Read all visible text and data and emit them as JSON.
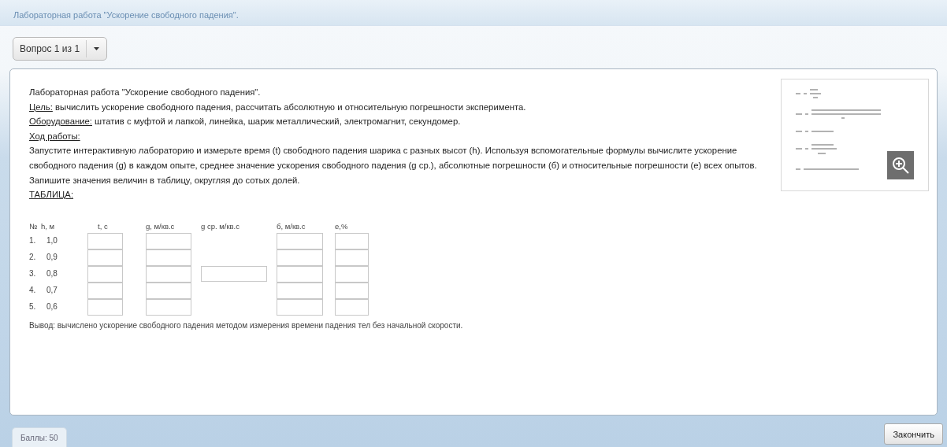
{
  "header": {
    "title": "Лабораторная работа \"Ускорение свободного падения\"."
  },
  "question_selector": {
    "label": "Вопрос 1 из 1"
  },
  "task": {
    "title": "Лабораторная работа \"Ускорение свободного падения\".",
    "paragraphs": [
      {
        "kind": "labeled",
        "label": "Цель:",
        "text": "вычислить ускорение свободного падения, рассчитать абсолютную и относительную погрешности эксперимента."
      },
      {
        "kind": "labeled",
        "label": "Оборудование:",
        "text": "штатив с муфтой и лапкой, линейка, шарик металлический, электромагнит, секундомер."
      },
      {
        "kind": "heading",
        "text": "Ход работы:"
      },
      {
        "kind": "plain",
        "text": "Запустите интерактивную лабораторию и измерьте время (t) свободного падения шарика с разных высот (h). Используя вспомогательные формулы вычислите ускорение свободного падения (g) в каждом опыте, среднее значение ускорения свободного падения (g ср.), абсолютные погрешности (б) и относительные погрешности (е) всех опытов. Запишите значения величин в таблицу, округляя до сотых долей."
      },
      {
        "kind": "heading",
        "text": "ТАБЛИЦА:"
      }
    ],
    "table": {
      "columns": [
        {
          "label": "№",
          "kind": "text"
        },
        {
          "label": "h, м",
          "kind": "text"
        },
        {
          "label": "t, c",
          "kind": "input"
        },
        {
          "label": "g, м/кв.с",
          "kind": "input"
        },
        {
          "label": "g ср. м/кв.с",
          "kind": "single"
        },
        {
          "label": "б, м/кв.с",
          "kind": "input"
        },
        {
          "label": "е,%",
          "kind": "input"
        }
      ],
      "rows": [
        {
          "cells": [
            "1.",
            "1,0"
          ]
        },
        {
          "cells": [
            "2.",
            "0,9"
          ]
        },
        {
          "cells": [
            "3.",
            "0,8"
          ]
        },
        {
          "cells": [
            "4.",
            "0,7"
          ]
        },
        {
          "cells": [
            "5.",
            "0,6"
          ]
        }
      ]
    },
    "conclusion": "Вывод: вычислено ускорение свободного падения методом измерения времени падения тел без начальной скорости."
  },
  "footer": {
    "score": "Баллы: 50",
    "finish_button": "Закончить"
  }
}
